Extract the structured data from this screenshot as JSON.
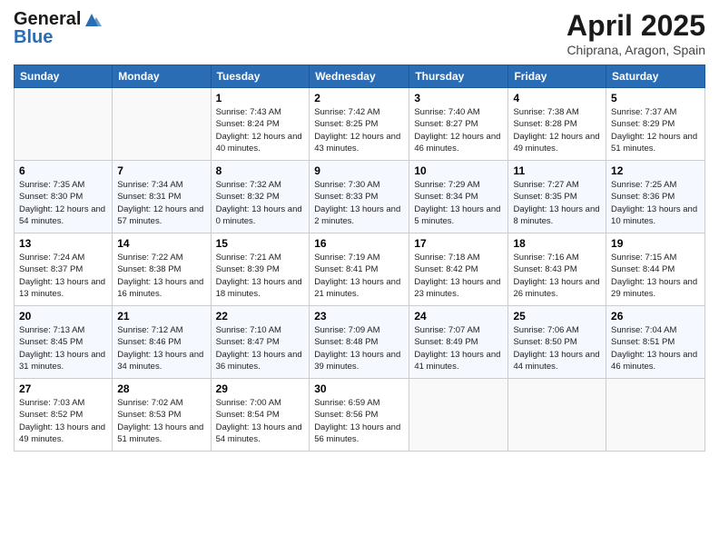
{
  "header": {
    "logo_line1": "General",
    "logo_line2": "Blue",
    "month": "April 2025",
    "location": "Chiprana, Aragon, Spain"
  },
  "days_of_week": [
    "Sunday",
    "Monday",
    "Tuesday",
    "Wednesday",
    "Thursday",
    "Friday",
    "Saturday"
  ],
  "weeks": [
    [
      {
        "day": "",
        "info": ""
      },
      {
        "day": "",
        "info": ""
      },
      {
        "day": "1",
        "info": "Sunrise: 7:43 AM\nSunset: 8:24 PM\nDaylight: 12 hours and 40 minutes."
      },
      {
        "day": "2",
        "info": "Sunrise: 7:42 AM\nSunset: 8:25 PM\nDaylight: 12 hours and 43 minutes."
      },
      {
        "day": "3",
        "info": "Sunrise: 7:40 AM\nSunset: 8:27 PM\nDaylight: 12 hours and 46 minutes."
      },
      {
        "day": "4",
        "info": "Sunrise: 7:38 AM\nSunset: 8:28 PM\nDaylight: 12 hours and 49 minutes."
      },
      {
        "day": "5",
        "info": "Sunrise: 7:37 AM\nSunset: 8:29 PM\nDaylight: 12 hours and 51 minutes."
      }
    ],
    [
      {
        "day": "6",
        "info": "Sunrise: 7:35 AM\nSunset: 8:30 PM\nDaylight: 12 hours and 54 minutes."
      },
      {
        "day": "7",
        "info": "Sunrise: 7:34 AM\nSunset: 8:31 PM\nDaylight: 12 hours and 57 minutes."
      },
      {
        "day": "8",
        "info": "Sunrise: 7:32 AM\nSunset: 8:32 PM\nDaylight: 13 hours and 0 minutes."
      },
      {
        "day": "9",
        "info": "Sunrise: 7:30 AM\nSunset: 8:33 PM\nDaylight: 13 hours and 2 minutes."
      },
      {
        "day": "10",
        "info": "Sunrise: 7:29 AM\nSunset: 8:34 PM\nDaylight: 13 hours and 5 minutes."
      },
      {
        "day": "11",
        "info": "Sunrise: 7:27 AM\nSunset: 8:35 PM\nDaylight: 13 hours and 8 minutes."
      },
      {
        "day": "12",
        "info": "Sunrise: 7:25 AM\nSunset: 8:36 PM\nDaylight: 13 hours and 10 minutes."
      }
    ],
    [
      {
        "day": "13",
        "info": "Sunrise: 7:24 AM\nSunset: 8:37 PM\nDaylight: 13 hours and 13 minutes."
      },
      {
        "day": "14",
        "info": "Sunrise: 7:22 AM\nSunset: 8:38 PM\nDaylight: 13 hours and 16 minutes."
      },
      {
        "day": "15",
        "info": "Sunrise: 7:21 AM\nSunset: 8:39 PM\nDaylight: 13 hours and 18 minutes."
      },
      {
        "day": "16",
        "info": "Sunrise: 7:19 AM\nSunset: 8:41 PM\nDaylight: 13 hours and 21 minutes."
      },
      {
        "day": "17",
        "info": "Sunrise: 7:18 AM\nSunset: 8:42 PM\nDaylight: 13 hours and 23 minutes."
      },
      {
        "day": "18",
        "info": "Sunrise: 7:16 AM\nSunset: 8:43 PM\nDaylight: 13 hours and 26 minutes."
      },
      {
        "day": "19",
        "info": "Sunrise: 7:15 AM\nSunset: 8:44 PM\nDaylight: 13 hours and 29 minutes."
      }
    ],
    [
      {
        "day": "20",
        "info": "Sunrise: 7:13 AM\nSunset: 8:45 PM\nDaylight: 13 hours and 31 minutes."
      },
      {
        "day": "21",
        "info": "Sunrise: 7:12 AM\nSunset: 8:46 PM\nDaylight: 13 hours and 34 minutes."
      },
      {
        "day": "22",
        "info": "Sunrise: 7:10 AM\nSunset: 8:47 PM\nDaylight: 13 hours and 36 minutes."
      },
      {
        "day": "23",
        "info": "Sunrise: 7:09 AM\nSunset: 8:48 PM\nDaylight: 13 hours and 39 minutes."
      },
      {
        "day": "24",
        "info": "Sunrise: 7:07 AM\nSunset: 8:49 PM\nDaylight: 13 hours and 41 minutes."
      },
      {
        "day": "25",
        "info": "Sunrise: 7:06 AM\nSunset: 8:50 PM\nDaylight: 13 hours and 44 minutes."
      },
      {
        "day": "26",
        "info": "Sunrise: 7:04 AM\nSunset: 8:51 PM\nDaylight: 13 hours and 46 minutes."
      }
    ],
    [
      {
        "day": "27",
        "info": "Sunrise: 7:03 AM\nSunset: 8:52 PM\nDaylight: 13 hours and 49 minutes."
      },
      {
        "day": "28",
        "info": "Sunrise: 7:02 AM\nSunset: 8:53 PM\nDaylight: 13 hours and 51 minutes."
      },
      {
        "day": "29",
        "info": "Sunrise: 7:00 AM\nSunset: 8:54 PM\nDaylight: 13 hours and 54 minutes."
      },
      {
        "day": "30",
        "info": "Sunrise: 6:59 AM\nSunset: 8:56 PM\nDaylight: 13 hours and 56 minutes."
      },
      {
        "day": "",
        "info": ""
      },
      {
        "day": "",
        "info": ""
      },
      {
        "day": "",
        "info": ""
      }
    ]
  ]
}
